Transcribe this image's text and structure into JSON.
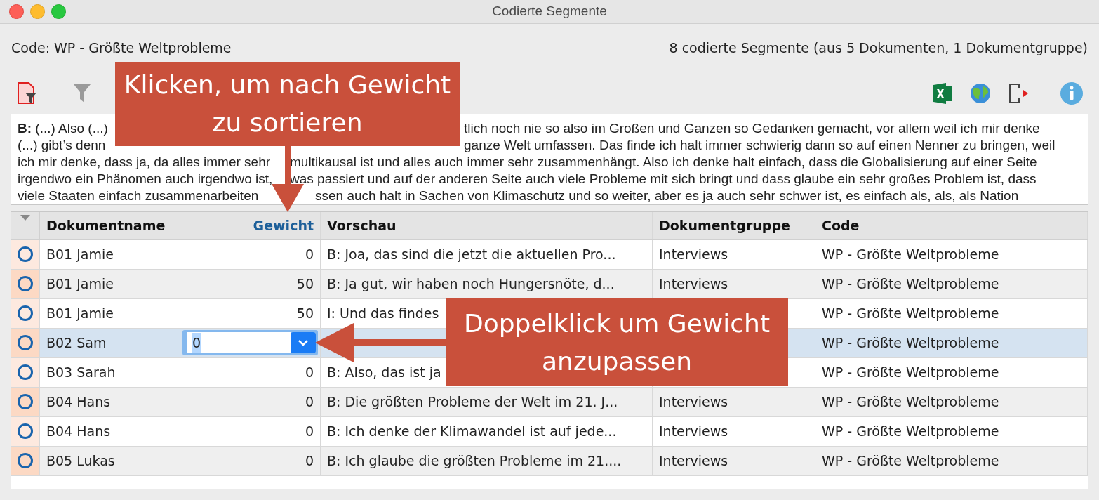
{
  "window": {
    "title": "Codierte Segmente"
  },
  "code_label": "Code: WP - Größte Weltprobleme",
  "summary": "8 codierte Segmente (aus 5 Dokumenten, 1 Dokumentgruppe)",
  "segment_text": [
    {
      "left": "**B:** (...) Also (...)",
      "right": "tlich noch nie so also im Großen und Ganzen so Gedanken gemacht, vor allem weil ich mir denke"
    },
    {
      "left": "(...) gibt’s denn",
      "right": "ganze Welt umfassen. Das finde ich halt immer schwierig dann so auf einen Nenner zu bringen, weil"
    },
    {
      "left": "ich mir denke, dass ja, da alles immer sehr",
      "right": "multikausal ist und alles auch immer sehr zusammenhängt. Also ich denke halt einfach, dass die Globalisierung auf einer Seite"
    },
    {
      "left": "irgendwo ein Phänomen auch irgendwo ist,",
      "right": "was passiert und auf der anderen Seite auch viele Probleme mit sich bringt und dass glaube ein sehr großes Problem ist, dass"
    },
    {
      "left": "viele Staaten einfach zusammenarbeiten",
      "right": "ssen auch halt in Sachen von Klimaschutz und so weiter, aber es ja auch sehr schwer ist, es einfach als, als, als Nation"
    }
  ],
  "table": {
    "columns": [
      {
        "label": "Dokumentname",
        "sorted": false
      },
      {
        "label": "Gewicht",
        "sorted": true
      },
      {
        "label": "Vorschau",
        "sorted": false
      },
      {
        "label": "Dokumentgruppe",
        "sorted": false
      },
      {
        "label": "Code",
        "sorted": false
      }
    ],
    "rows": [
      {
        "selected": false,
        "document": "B01 Jamie",
        "weight": {
          "kind": "text",
          "value": "0"
        },
        "preview": "B: Joa, das sind die jetzt die aktuellen Pro...",
        "group": "Interviews",
        "code": "WP - Größte Weltprobleme"
      },
      {
        "selected": false,
        "document": "B01 Jamie",
        "weight": {
          "kind": "text",
          "value": "50"
        },
        "preview": "B: Ja gut, wir haben noch Hungersnöte, d...",
        "group": "Interviews",
        "code": "WP - Größte Weltprobleme"
      },
      {
        "selected": false,
        "document": "B01 Jamie",
        "weight": {
          "kind": "text",
          "value": "50"
        },
        "preview": "I: Und das findes",
        "code": "WP - Größte Weltprobleme"
      },
      {
        "selected": true,
        "document": "B02 Sam",
        "weight": {
          "kind": "edit",
          "value": "0"
        },
        "code": "WP - Größte Weltprobleme"
      },
      {
        "selected": false,
        "document": "B03 Sarah",
        "weight": {
          "kind": "text",
          "value": "0"
        },
        "preview": "B: Also, das ist ja",
        "code": "WP - Größte Weltprobleme"
      },
      {
        "selected": false,
        "document": "B04 Hans",
        "weight": {
          "kind": "text",
          "value": "0"
        },
        "preview": "B: Die größten Probleme der Welt im 21. J...",
        "group": "Interviews",
        "code": "WP - Größte Weltprobleme"
      },
      {
        "selected": false,
        "document": "B04 Hans",
        "weight": {
          "kind": "text",
          "value": "0"
        },
        "preview": "B: Ich denke der Klimawandel ist auf jede...",
        "group": "Interviews",
        "code": "WP - Größte Weltprobleme"
      },
      {
        "selected": false,
        "document": "B05 Lukas",
        "weight": {
          "kind": "text",
          "value": "0"
        },
        "preview": "B: Ich glaube die größten Probleme im 21....",
        "group": "Interviews",
        "code": "WP - Größte Weltprobleme"
      }
    ]
  },
  "callouts": [
    {
      "kind": "down",
      "text": "Klicken, um nach Gewicht zu sortieren"
    },
    {
      "kind": "left",
      "text": "Doppelklick um Gewicht anzupassen"
    }
  ]
}
